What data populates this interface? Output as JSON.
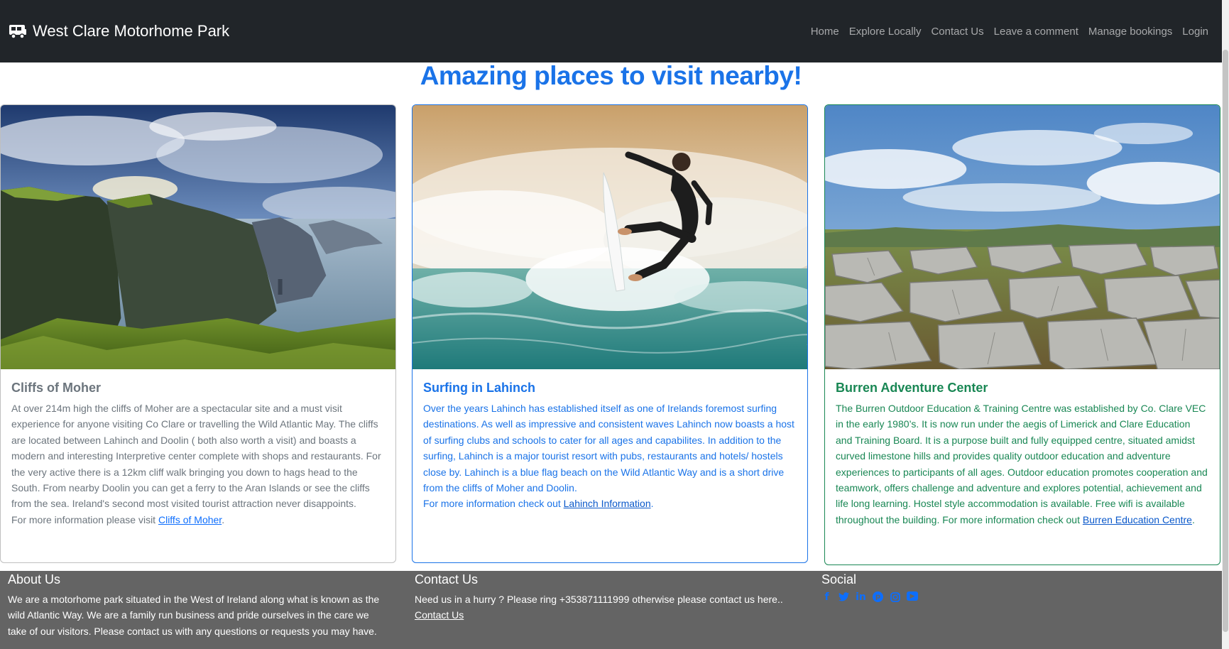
{
  "navbar": {
    "brand": "West Clare Motorhome Park",
    "brand_icon": "motorhome-icon",
    "links": [
      "Home",
      "Explore Locally",
      "Contact Us",
      "Leave a comment",
      "Manage bookings",
      "Login"
    ]
  },
  "page_title": "Amazing places to visit nearby!",
  "cards": [
    {
      "title": "Cliffs of Moher",
      "text": "At over 214m high the cliffs of Moher are a spectacular site and a must visit experience for anyone visiting Co Clare or travelling the Wild Atlantic May. The cliffs are located between Lahinch and Doolin ( both also worth a visit) and boasts a modern and interesting Interpretive center complete with shops and restaurants. For the very active there is a 12km cliff walk bringing you down to hags head to the South. From nearby Doolin you can get a ferry to the Aran Islands or see the cliffs from the sea. Ireland's second most visited tourist attraction never disappoints.",
      "more_prefix": "For more information please visit ",
      "link_text": "Cliffs of Moher",
      "suffix": ".",
      "image": "cliffs-photo",
      "color": "#6c757d"
    },
    {
      "title": "Surfing in Lahinch",
      "text": "Over the years Lahinch has established itself as one of Irelands foremost surfing destinations. As well as impressive and consistent waves Lahinch now boasts a host of surfing clubs and schools to cater for all ages and capabilites. In addition to the surfing, Lahinch is a major tourist resort with pubs, restaurants and hotels/ hostels close by. Lahinch is a blue flag beach on the Wild Atlantic Way and is a short drive from the cliffs of Moher and Doolin.",
      "more_prefix": "For more information check out ",
      "link_text": "Lahinch Information",
      "suffix": ".",
      "image": "surfer-photo",
      "color": "#1a73e8"
    },
    {
      "title": "Burren Adventure Center",
      "text": "The Burren Outdoor Education & Training Centre was established by Co. Clare VEC in the early 1980’s. It is now run under the aegis of Limerick and Clare Education and Training Board. It is a purpose built and fully equipped centre, situated amidst curved limestone hills and provides quality outdoor education and adventure experiences to participants of all ages. Outdoor education promotes cooperation and teamwork, offers challenge and adventure and explores potential, achievement and life long learning. Hostel style accommodation is available. Free wifi is available throughout the building. For more information check out ",
      "more_prefix": "",
      "link_text": "Burren Education Centre",
      "suffix": ".",
      "image": "burren-photo",
      "color": "#198754"
    }
  ],
  "footer": {
    "about": {
      "title": "About Us",
      "text": "We are a motorhome park situated in the West of Ireland along what is known as the wild Atlantic Way. We are a family run business and pride ourselves in the care we take of our visitors. Please contact us with any questions or requests you may have."
    },
    "contact": {
      "title": "Contact Us",
      "text": "Need us in a hurry ? Please ring +353871111999 otherwise please contact us here..",
      "link_text": "Contact Us"
    },
    "social": {
      "title": "Social",
      "icons": [
        "facebook-icon",
        "twitter-icon",
        "linkedin-icon",
        "pinterest-icon",
        "instagram-icon",
        "youtube-icon"
      ]
    }
  }
}
